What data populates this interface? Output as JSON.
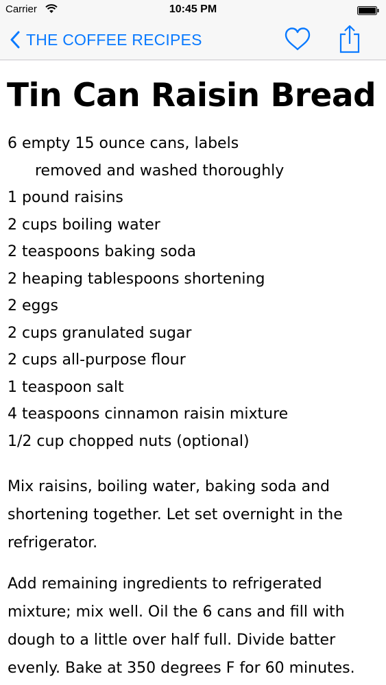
{
  "status_bar": {
    "carrier": "Carrier",
    "time": "10:45 PM",
    "icons": [
      "wifi-icon",
      "battery-icon"
    ]
  },
  "nav": {
    "back_label": "THE COFFEE RECIPES",
    "accent_color": "#0a7aff",
    "icons": [
      "chevron-left-icon",
      "heart-icon",
      "share-icon"
    ]
  },
  "recipe": {
    "title": "Tin Can Raisin Bread",
    "ingredients": [
      "6 empty 15 ounce cans, labels",
      "removed and washed thoroughly",
      "1 pound raisins",
      "2 cups boiling water",
      "2 teaspoons baking soda",
      "2 heaping tablespoons shortening",
      "2 eggs",
      "2 cups granulated sugar",
      "2 cups all-purpose flour",
      "1 teaspoon salt",
      "4 teaspoons cinnamon raisin mixture",
      "1/2 cup chopped nuts (optional)"
    ],
    "directions": [
      "Mix raisins, boiling water, baking soda and shortening together. Let set overnight in the refrigerator.",
      "Add remaining ingredients to refrigerated mixture; mix well. Oil the 6 cans and fill with dough to a little over half full. Divide batter evenly. Bake at 350 degrees F for 60 minutes."
    ]
  }
}
